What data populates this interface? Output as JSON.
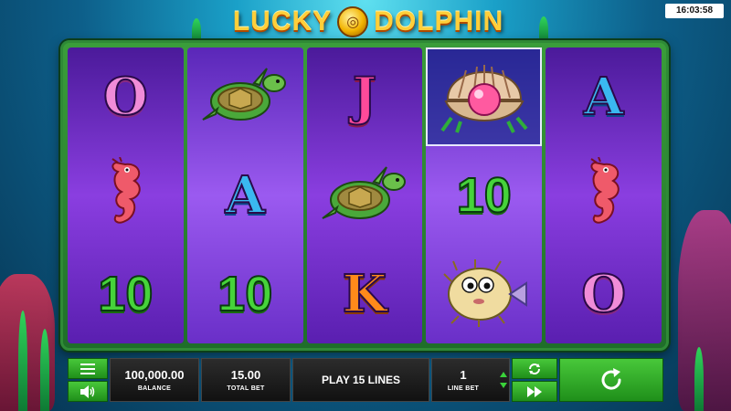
{
  "clock": "16:03:58",
  "logo": {
    "word1": "LUCKY",
    "word2": "DOLPHIN"
  },
  "reels": [
    [
      {
        "symbol": "O",
        "type": "letter"
      },
      {
        "symbol": "seahorse",
        "type": "image"
      },
      {
        "symbol": "10",
        "type": "ten"
      }
    ],
    [
      {
        "symbol": "turtle",
        "type": "image"
      },
      {
        "symbol": "A",
        "type": "letter"
      },
      {
        "symbol": "10",
        "type": "ten"
      }
    ],
    [
      {
        "symbol": "J",
        "type": "letter"
      },
      {
        "symbol": "turtle",
        "type": "image"
      },
      {
        "symbol": "K",
        "type": "letter"
      }
    ],
    [
      {
        "symbol": "pearl-clam",
        "type": "image",
        "highlighted": true
      },
      {
        "symbol": "10",
        "type": "ten"
      },
      {
        "symbol": "pufferfish",
        "type": "image"
      }
    ],
    [
      {
        "symbol": "A",
        "type": "letter"
      },
      {
        "symbol": "seahorse",
        "type": "image"
      },
      {
        "symbol": "O",
        "type": "letter"
      }
    ]
  ],
  "controls": {
    "balance_value": "100,000.00",
    "balance_label": "BALANCE",
    "total_bet_value": "15.00",
    "total_bet_label": "TOTAL BET",
    "play_lines_label": "PLAY 15 LINES",
    "line_bet_value": "1",
    "line_bet_label": "LINE BET",
    "menu_icon": "hamburger-icon",
    "sound_icon": "speaker-icon",
    "autoplay_icon": "autoplay-icon",
    "turbo_icon": "fast-forward-icon",
    "spin_icon": "spin-icon"
  },
  "colors": {
    "button_green": "#2fa82a",
    "panel_dark": "#1a1a1a",
    "reel_purple": "#7a35d0",
    "frame_green": "#2f8a36"
  }
}
